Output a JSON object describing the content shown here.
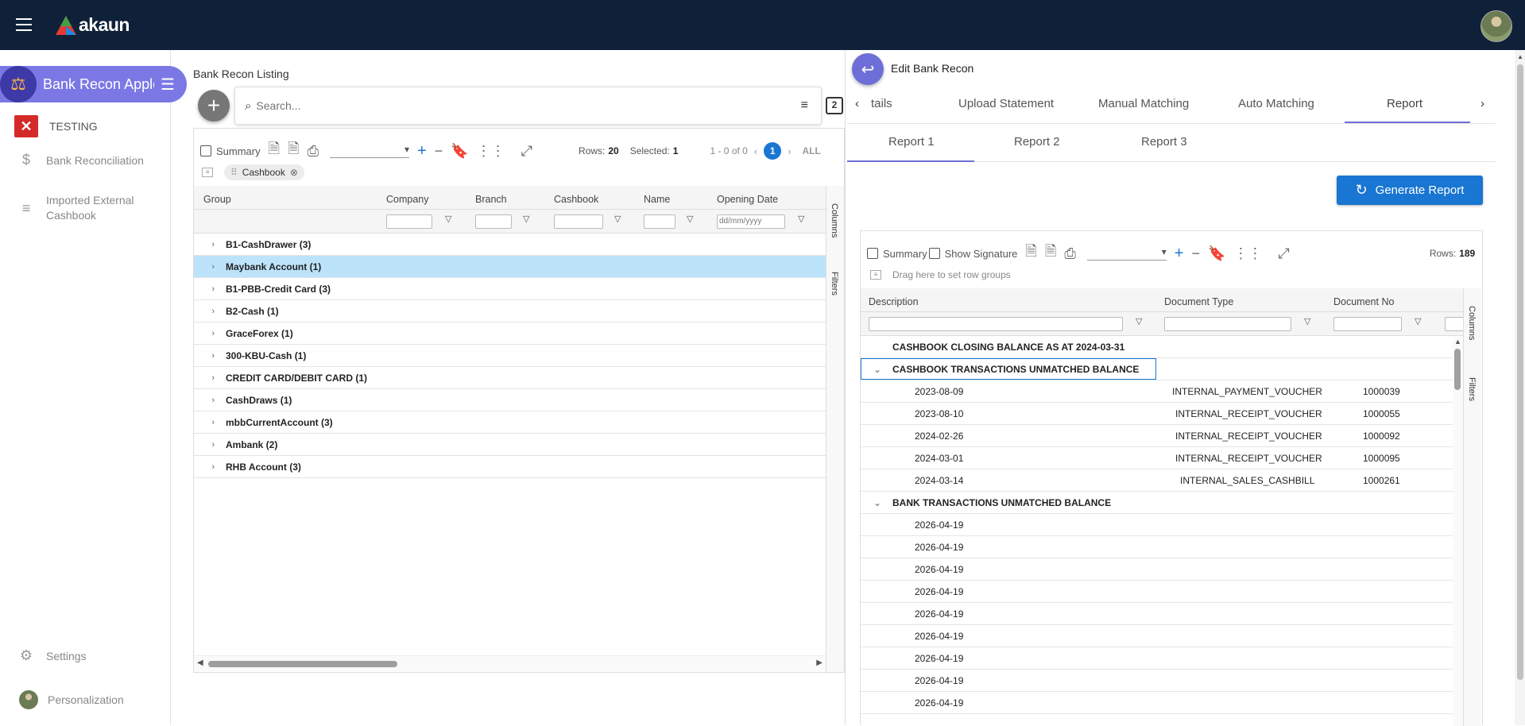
{
  "app": {
    "brand": "akaun"
  },
  "sidebar": {
    "app_title": "Bank Recon Applet",
    "items": [
      {
        "label": "TESTING"
      },
      {
        "label": "Bank Reconciliation"
      },
      {
        "label": "Imported External Cashbook"
      }
    ],
    "settings_label": "Settings",
    "personalization_label": "Personalization"
  },
  "left": {
    "title": "Bank Recon Listing",
    "search_placeholder": "Search...",
    "copy_count": "2",
    "summary_label": "Summary",
    "rows_label": "Rows:",
    "rows_value": "20",
    "selected_label": "Selected:",
    "selected_value": "1",
    "paging": "1 - 0 of 0",
    "page": "1",
    "all_label": "ALL",
    "chip": "Cashbook",
    "columns": [
      "Group",
      "Company",
      "Branch",
      "Cashbook",
      "Name",
      "Opening Date"
    ],
    "date_placeholder": "dd/mm/yyyy",
    "groups": [
      "B1-CashDrawer (3)",
      "Maybank Account (1)",
      "B1-PBB-Credit Card (3)",
      "B2-Cash (1)",
      "GraceForex (1)",
      "300-KBU-Cash (1)",
      "CREDIT CARD/DEBIT CARD (1)",
      "CashDraws (1)",
      "mbbCurrentAccount (3)",
      "Ambank (2)",
      "RHB Account (3)"
    ],
    "side_tabs": [
      "Columns",
      "Filters"
    ]
  },
  "right": {
    "title": "Edit Bank Recon",
    "tabs": [
      "tails",
      "Upload Statement",
      "Manual Matching",
      "Auto Matching",
      "Report"
    ],
    "subtabs": [
      "Report 1",
      "Report 2",
      "Report 3"
    ],
    "generate_label": "Generate Report",
    "summary_label": "Summary",
    "show_signature_label": "Show Signature",
    "rows_label": "Rows:",
    "rows_value": "189",
    "row_group_hint": "Drag here to set row groups",
    "columns": [
      "Description",
      "Document Type",
      "Document No"
    ],
    "closing_balance": "CASHBOOK CLOSING BALANCE AS AT 2024-03-31",
    "cashbook_group": "CASHBOOK TRANSACTIONS UNMATCHED BALANCE",
    "cashbook_rows": [
      {
        "date": "2023-08-09",
        "type": "INTERNAL_PAYMENT_VOUCHER",
        "no": "1000039"
      },
      {
        "date": "2023-08-10",
        "type": "INTERNAL_RECEIPT_VOUCHER",
        "no": "1000055"
      },
      {
        "date": "2024-02-26",
        "type": "INTERNAL_RECEIPT_VOUCHER",
        "no": "1000092"
      },
      {
        "date": "2024-03-01",
        "type": "INTERNAL_RECEIPT_VOUCHER",
        "no": "1000095"
      },
      {
        "date": "2024-03-14",
        "type": "INTERNAL_SALES_CASHBILL",
        "no": "1000261"
      }
    ],
    "bank_group": "BANK TRANSACTIONS UNMATCHED BALANCE",
    "bank_rows": [
      "2026-04-19",
      "2026-04-19",
      "2026-04-19",
      "2026-04-19",
      "2026-04-19",
      "2026-04-19",
      "2026-04-19",
      "2026-04-19",
      "2026-04-19"
    ],
    "side_tabs": [
      "Columns",
      "Filters"
    ]
  },
  "colors": {
    "topbar": "#0f2138",
    "accent": "#6e6ed8",
    "primary": "#1976d2",
    "selected_row": "#bde3fb"
  }
}
